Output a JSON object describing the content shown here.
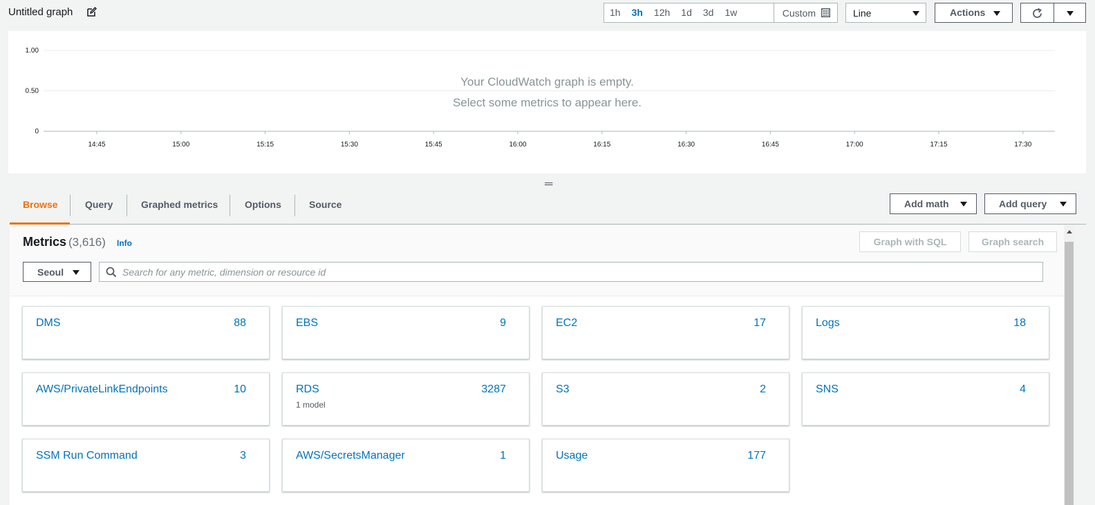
{
  "header": {
    "graph_title": "Untitled graph",
    "time_ranges": [
      "1h",
      "3h",
      "12h",
      "1d",
      "3d",
      "1w"
    ],
    "active_range": "3h",
    "custom_label": "Custom",
    "chart_type": "Line",
    "actions_label": "Actions"
  },
  "chart_data": {
    "type": "line",
    "series": [],
    "yticks": [
      "1.00",
      "0.50",
      "0"
    ],
    "xticks": [
      "14:45",
      "15:00",
      "15:15",
      "15:30",
      "15:45",
      "16:00",
      "16:15",
      "16:30",
      "16:45",
      "17:00",
      "17:15",
      "17:30"
    ],
    "ylim": [
      0,
      1
    ]
  },
  "empty_message": {
    "line1": "Your CloudWatch graph is empty.",
    "line2": "Select some metrics to appear here."
  },
  "tabs": [
    "Browse",
    "Query",
    "Graphed metrics",
    "Options",
    "Source"
  ],
  "toolbar": {
    "add_math": "Add math",
    "add_query": "Add query"
  },
  "metrics": {
    "title": "Metrics",
    "count": "(3,616)",
    "info": "Info",
    "graph_with_sql": "Graph with SQL",
    "graph_search": "Graph search",
    "region": "Seoul",
    "search_placeholder": "Search for any metric, dimension or resource id",
    "search_value": "",
    "namespaces": [
      {
        "name": "DMS",
        "count": "88",
        "sub": ""
      },
      {
        "name": "EBS",
        "count": "9",
        "sub": ""
      },
      {
        "name": "EC2",
        "count": "17",
        "sub": ""
      },
      {
        "name": "Logs",
        "count": "18",
        "sub": ""
      },
      {
        "name": "AWS/PrivateLinkEndpoints",
        "count": "10",
        "sub": ""
      },
      {
        "name": "RDS",
        "count": "3287",
        "sub": "1 model"
      },
      {
        "name": "S3",
        "count": "2",
        "sub": ""
      },
      {
        "name": "SNS",
        "count": "4",
        "sub": ""
      },
      {
        "name": "SSM Run Command",
        "count": "3",
        "sub": ""
      },
      {
        "name": "AWS/SecretsManager",
        "count": "1",
        "sub": ""
      },
      {
        "name": "Usage",
        "count": "177",
        "sub": ""
      }
    ]
  },
  "colors": {
    "accent": "#ec7211",
    "link": "#0073bb"
  }
}
